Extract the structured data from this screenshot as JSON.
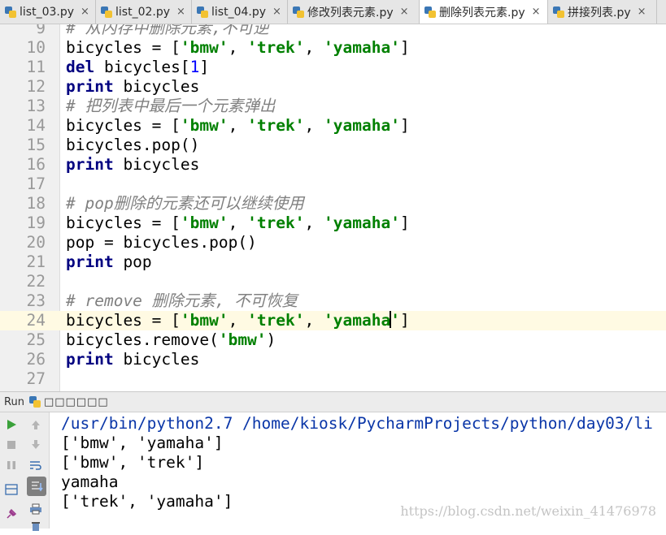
{
  "tabs": [
    {
      "label": "list_03.py",
      "active": false
    },
    {
      "label": "list_02.py",
      "active": false
    },
    {
      "label": "list_04.py",
      "active": false
    },
    {
      "label": "修改列表元素.py",
      "active": false
    },
    {
      "label": "删除列表元素.py",
      "active": true
    },
    {
      "label": "拼接列表.py",
      "active": false
    }
  ],
  "tab_close_glyph": "×",
  "editor": {
    "current_line": "24",
    "lines": [
      {
        "num": "9",
        "parts": [
          {
            "t": "cm",
            "v": "# 从内存中删除元素,不可逆"
          }
        ]
      },
      {
        "num": "10",
        "parts": [
          {
            "t": "tx",
            "v": "bicycles = ["
          },
          {
            "t": "str",
            "v": "'bmw'"
          },
          {
            "t": "tx",
            "v": ", "
          },
          {
            "t": "str",
            "v": "'trek'"
          },
          {
            "t": "tx",
            "v": ", "
          },
          {
            "t": "str",
            "v": "'yamaha'"
          },
          {
            "t": "tx",
            "v": "]"
          }
        ]
      },
      {
        "num": "11",
        "parts": [
          {
            "t": "kw",
            "v": "del"
          },
          {
            "t": "tx",
            "v": " bicycles["
          },
          {
            "t": "num",
            "v": "1"
          },
          {
            "t": "tx",
            "v": "]"
          }
        ]
      },
      {
        "num": "12",
        "parts": [
          {
            "t": "kw",
            "v": "print"
          },
          {
            "t": "tx",
            "v": " bicycles"
          }
        ]
      },
      {
        "num": "13",
        "parts": [
          {
            "t": "cm",
            "v": "# 把列表中最后一个元素弹出"
          }
        ]
      },
      {
        "num": "14",
        "parts": [
          {
            "t": "tx",
            "v": "bicycles = ["
          },
          {
            "t": "str",
            "v": "'bmw'"
          },
          {
            "t": "tx",
            "v": ", "
          },
          {
            "t": "str",
            "v": "'trek'"
          },
          {
            "t": "tx",
            "v": ", "
          },
          {
            "t": "str",
            "v": "'yamaha'"
          },
          {
            "t": "tx",
            "v": "]"
          }
        ]
      },
      {
        "num": "15",
        "parts": [
          {
            "t": "tx",
            "v": "bicycles.pop()"
          }
        ]
      },
      {
        "num": "16",
        "parts": [
          {
            "t": "kw",
            "v": "print"
          },
          {
            "t": "tx",
            "v": " bicycles"
          }
        ]
      },
      {
        "num": "17",
        "parts": []
      },
      {
        "num": "18",
        "parts": [
          {
            "t": "cm",
            "v": "# pop删除的元素还可以继续使用"
          }
        ]
      },
      {
        "num": "19",
        "parts": [
          {
            "t": "tx",
            "v": "bicycles = ["
          },
          {
            "t": "str",
            "v": "'bmw'"
          },
          {
            "t": "tx",
            "v": ", "
          },
          {
            "t": "str",
            "v": "'trek'"
          },
          {
            "t": "tx",
            "v": ", "
          },
          {
            "t": "str",
            "v": "'yamaha'"
          },
          {
            "t": "tx",
            "v": "]"
          }
        ]
      },
      {
        "num": "20",
        "parts": [
          {
            "t": "tx",
            "v": "pop = bicycles.pop()"
          }
        ]
      },
      {
        "num": "21",
        "parts": [
          {
            "t": "kw",
            "v": "print"
          },
          {
            "t": "tx",
            "v": " pop"
          }
        ]
      },
      {
        "num": "22",
        "parts": []
      },
      {
        "num": "23",
        "parts": [
          {
            "t": "cm",
            "v": "# remove 删除元素, 不可恢复"
          }
        ]
      },
      {
        "num": "24",
        "parts": [
          {
            "t": "tx",
            "v": "bicycles = ["
          },
          {
            "t": "str",
            "v": "'bmw'"
          },
          {
            "t": "tx",
            "v": ", "
          },
          {
            "t": "str",
            "v": "'trek'"
          },
          {
            "t": "tx",
            "v": ", "
          },
          {
            "t": "str",
            "v": "'yamaha"
          },
          {
            "t": "caret",
            "v": ""
          },
          {
            "t": "str",
            "v": "'"
          },
          {
            "t": "tx",
            "v": "]"
          }
        ]
      },
      {
        "num": "25",
        "parts": [
          {
            "t": "tx",
            "v": "bicycles.remove("
          },
          {
            "t": "str",
            "v": "'bmw'"
          },
          {
            "t": "tx",
            "v": ")"
          }
        ]
      },
      {
        "num": "26",
        "parts": [
          {
            "t": "kw",
            "v": "print"
          },
          {
            "t": "tx",
            "v": " bicycles"
          }
        ]
      },
      {
        "num": "27",
        "parts": []
      }
    ]
  },
  "run": {
    "label": "Run",
    "config_name": "□□□□□□",
    "toolbar_icons": [
      "run-icon",
      "up-arrow-icon",
      "stop-icon",
      "down-arrow-icon",
      "pause-icon",
      "soft-wrap-icon",
      "layout-icon",
      "scroll-to-end-icon",
      "pin-icon",
      "print-icon",
      "delete-icon"
    ]
  },
  "console": {
    "lines": [
      "/usr/bin/python2.7 /home/kiosk/PycharmProjects/python/day03/li",
      "['bmw', 'yamaha']",
      "['bmw', 'trek']",
      "yamaha",
      "['trek', 'yamaha']"
    ]
  },
  "watermark": "https://blog.csdn.net/weixin_41476978",
  "colors": {
    "keyword": "#000080",
    "string": "#008000",
    "number": "#0000ff",
    "comment": "#808080",
    "current_line": "#fffae3",
    "console_path": "#0a36a8"
  }
}
